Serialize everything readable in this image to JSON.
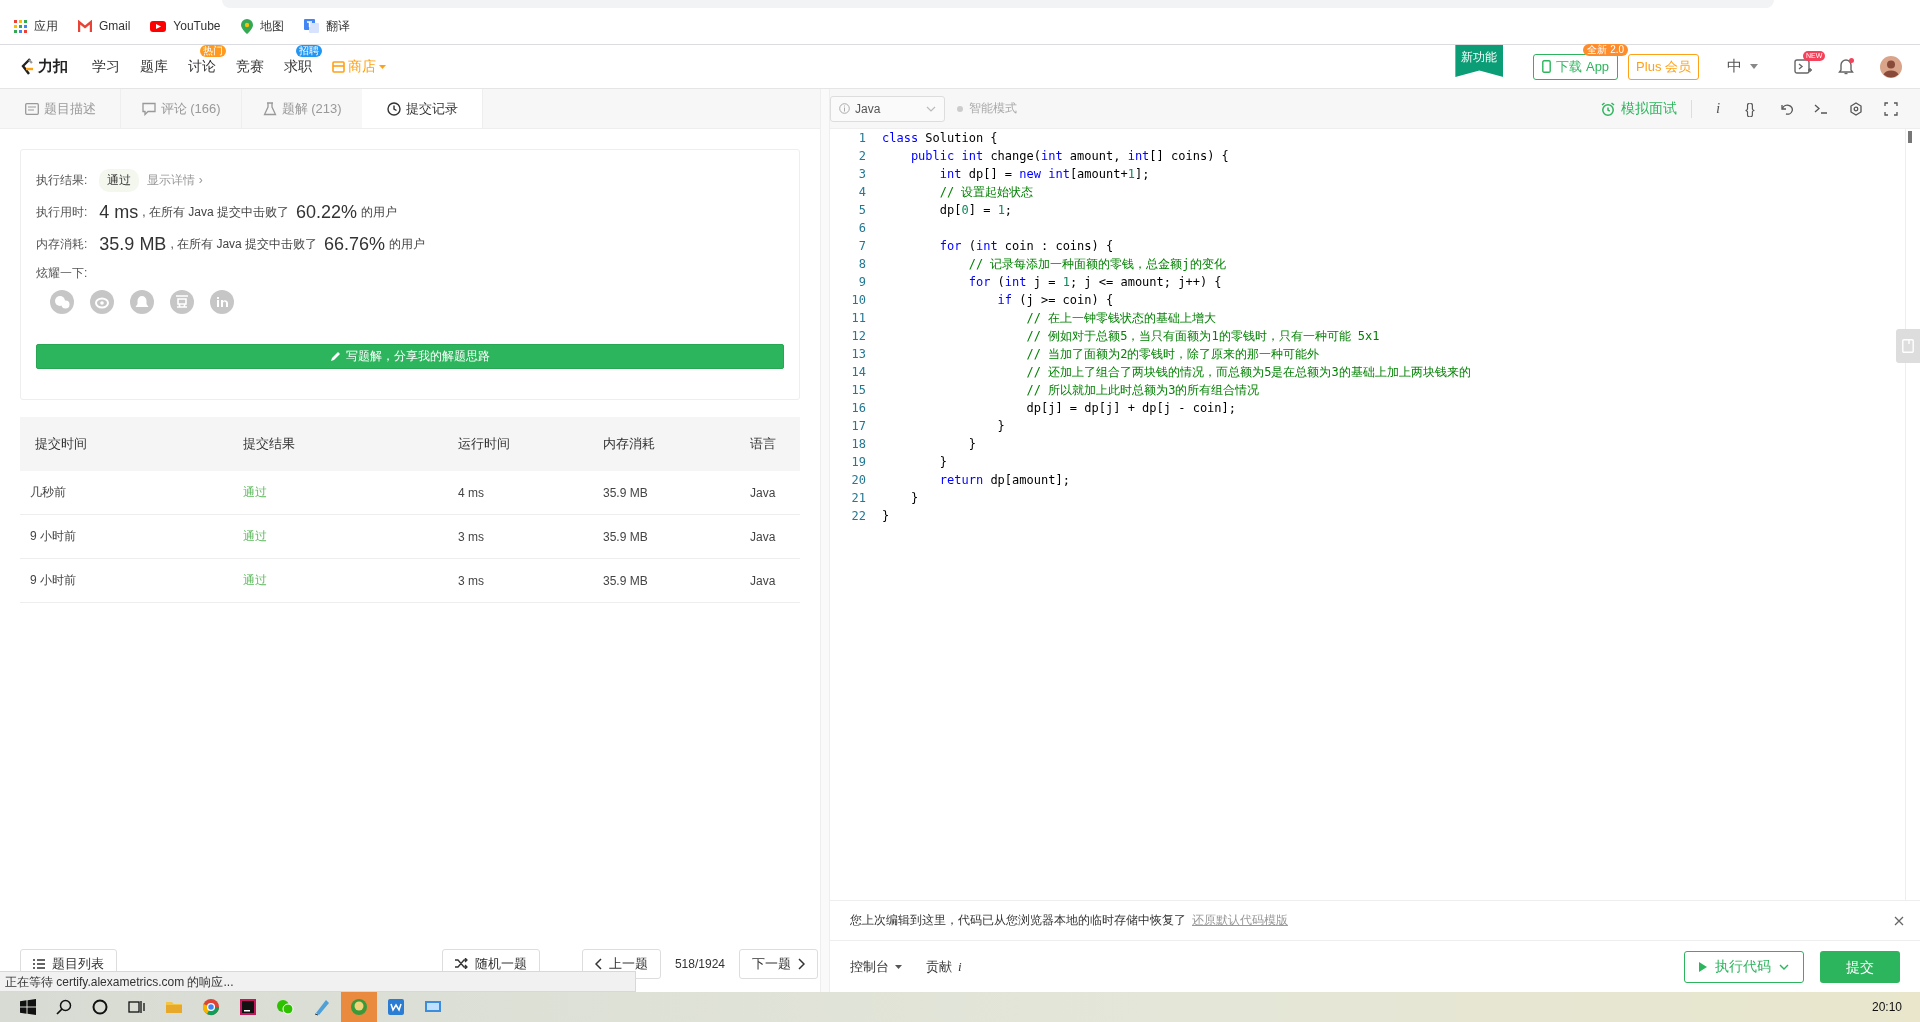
{
  "browser": {
    "bookmarks": [
      {
        "label": "应用"
      },
      {
        "label": "Gmail"
      },
      {
        "label": "YouTube"
      },
      {
        "label": "地图"
      },
      {
        "label": "翻译"
      }
    ]
  },
  "nav": {
    "logo": "力扣",
    "items": [
      {
        "label": "学习",
        "kind": "link"
      },
      {
        "label": "题库",
        "kind": "link"
      },
      {
        "label": "讨论",
        "kind": "link",
        "badge": {
          "text": "热门",
          "color": "#ff9a1f"
        }
      },
      {
        "label": "竞赛",
        "kind": "link"
      },
      {
        "label": "求职",
        "kind": "link",
        "badge": {
          "text": "招聘",
          "color": "#2196f3"
        }
      },
      {
        "label": "商店",
        "kind": "menu"
      }
    ],
    "new_feature": "新功能",
    "download": {
      "label": "下载 App",
      "badge": "全新 2.0"
    },
    "plus": "Plus 会员",
    "language": {
      "label": "中",
      "expanded": false
    },
    "playground_badge": "NEW",
    "notifications": {
      "unread": true
    }
  },
  "tabs": [
    {
      "label": "题目描述",
      "selected": false
    },
    {
      "label": "评论 (166)",
      "selected": false
    },
    {
      "label": "题解 (213)",
      "selected": false
    },
    {
      "label": "提交记录",
      "selected": true
    }
  ],
  "result": {
    "status_label": "执行结果:",
    "status": "通过",
    "details_link": "显示详情 ›",
    "runtime": {
      "label": "执行用时:",
      "value": "4 ms",
      "text": ", 在所有 Java 提交中击败了",
      "percent": "60.22%",
      "suffix": "的用户"
    },
    "memory": {
      "label": "内存消耗:",
      "value": "35.9 MB",
      "text": ", 在所有 Java 提交中击败了",
      "percent": "66.76%",
      "suffix": "的用户"
    },
    "share_label": "炫耀一下:",
    "write_button": "写题解，分享我的解题思路"
  },
  "submissions": {
    "columns": [
      "提交时间",
      "提交结果",
      "运行时间",
      "内存消耗",
      "语言"
    ],
    "rows": [
      {
        "time": "几秒前",
        "result": "通过",
        "runtime": "4 ms",
        "memory": "35.9 MB",
        "language": "Java"
      },
      {
        "time": "9 小时前",
        "result": "通过",
        "runtime": "3 ms",
        "memory": "35.9 MB",
        "language": "Java"
      },
      {
        "time": "9 小时前",
        "result": "通过",
        "runtime": "3 ms",
        "memory": "35.9 MB",
        "language": "Java"
      }
    ]
  },
  "editor_toolbar": {
    "language": "Java",
    "smart_mode": {
      "label": "智能模式",
      "on": false
    },
    "mock_interview": "模拟面试",
    "glyph_tools": [
      "i",
      "{}"
    ]
  },
  "code": [
    {
      "number": "1",
      "tokens": [
        {
          "kind": "keyword",
          "text": "class"
        },
        {
          "kind": "plain",
          "text": " Solution {"
        }
      ]
    },
    {
      "number": "2",
      "tokens": [
        {
          "kind": "keyword",
          "text": "    public"
        },
        {
          "kind": "keyword",
          "text": " int"
        },
        {
          "kind": "plain",
          "text": " change("
        },
        {
          "kind": "keyword",
          "text": "int"
        },
        {
          "kind": "plain",
          "text": " amount, "
        },
        {
          "kind": "keyword",
          "text": "int"
        },
        {
          "kind": "plain",
          "text": "[] coins) {"
        }
      ]
    },
    {
      "number": "3",
      "tokens": [
        {
          "kind": "keyword",
          "text": "        int"
        },
        {
          "kind": "plain",
          "text": " dp[] = "
        },
        {
          "kind": "keyword",
          "text": "new"
        },
        {
          "kind": "keyword",
          "text": " int"
        },
        {
          "kind": "plain",
          "text": "[amount+"
        },
        {
          "kind": "number",
          "text": "1"
        },
        {
          "kind": "plain",
          "text": "];"
        }
      ]
    },
    {
      "number": "4",
      "tokens": [
        {
          "kind": "comment",
          "text": "        // 设置起始状态"
        }
      ]
    },
    {
      "number": "5",
      "tokens": [
        {
          "kind": "plain",
          "text": "        dp["
        },
        {
          "kind": "number",
          "text": "0"
        },
        {
          "kind": "plain",
          "text": "] = "
        },
        {
          "kind": "number",
          "text": "1"
        },
        {
          "kind": "plain",
          "text": ";"
        }
      ]
    },
    {
      "number": "6"
    },
    {
      "number": "7",
      "tokens": [
        {
          "kind": "keyword",
          "text": "        for"
        },
        {
          "kind": "plain",
          "text": " ("
        },
        {
          "kind": "keyword",
          "text": "int"
        },
        {
          "kind": "plain",
          "text": " coin : coins) {"
        }
      ]
    },
    {
      "number": "8",
      "tokens": [
        {
          "kind": "comment",
          "text": "            // 记录每添加一种面额的零钱，总金额j的变化"
        }
      ]
    },
    {
      "number": "9",
      "tokens": [
        {
          "kind": "keyword",
          "text": "            for"
        },
        {
          "kind": "plain",
          "text": " ("
        },
        {
          "kind": "keyword",
          "text": "int"
        },
        {
          "kind": "plain",
          "text": " j = "
        },
        {
          "kind": "number",
          "text": "1"
        },
        {
          "kind": "plain",
          "text": "; j <= amount; j++) {"
        }
      ]
    },
    {
      "number": "10",
      "tokens": [
        {
          "kind": "keyword",
          "text": "                if"
        },
        {
          "kind": "plain",
          "text": " (j >= coin) {"
        }
      ]
    },
    {
      "number": "11",
      "tokens": [
        {
          "kind": "comment",
          "text": "                    // 在上一钟零钱状态的基础上增大"
        }
      ]
    },
    {
      "number": "12",
      "tokens": [
        {
          "kind": "comment",
          "text": "                    // 例如对于总额5，当只有面额为1的零钱时，只有一种可能 5x1"
        }
      ]
    },
    {
      "number": "13",
      "tokens": [
        {
          "kind": "comment",
          "text": "                    // 当加了面额为2的零钱时，除了原来的那一种可能外"
        }
      ]
    },
    {
      "number": "14",
      "tokens": [
        {
          "kind": "comment",
          "text": "                    // 还加上了组合了两块钱的情况，而总额为5是在总额为3的基础上加上两块钱来的"
        }
      ]
    },
    {
      "number": "15",
      "tokens": [
        {
          "kind": "comment",
          "text": "                    // 所以就加上此时总额为3的所有组合情况"
        }
      ]
    },
    {
      "number": "16",
      "tokens": [
        {
          "kind": "plain",
          "text": "                    dp[j] = dp[j] + dp[j - coin];"
        }
      ]
    },
    {
      "number": "17",
      "tokens": [
        {
          "kind": "plain",
          "text": "                }"
        }
      ]
    },
    {
      "number": "18",
      "tokens": [
        {
          "kind": "plain",
          "text": "            }"
        }
      ]
    },
    {
      "number": "19",
      "tokens": [
        {
          "kind": "plain",
          "text": "        }"
        }
      ]
    },
    {
      "number": "20",
      "tokens": [
        {
          "kind": "keyword",
          "text": "        return"
        },
        {
          "kind": "plain",
          "text": " dp[amount];"
        }
      ]
    },
    {
      "number": "21",
      "tokens": [
        {
          "kind": "plain",
          "text": "    }"
        }
      ]
    },
    {
      "number": "22",
      "tokens": [
        {
          "kind": "plain",
          "text": "}"
        }
      ]
    }
  ],
  "notice": {
    "text": "您上次编辑到这里，代码已从您浏览器本地的临时存储中恢复了",
    "link": "还原默认代码模版"
  },
  "bottom": {
    "problem_list": "题目列表",
    "random": "随机一题",
    "prev": "上一题",
    "progress": "518/1924",
    "next": "下一题",
    "console": "控制台",
    "contribute": "贡献",
    "contribute_glyph": "i",
    "run": "执行代码",
    "submit": "提交"
  },
  "status_overlay": "正在等待 certify.alexametrics.com 的响应...",
  "taskbar": {
    "clock": "20:10"
  }
}
